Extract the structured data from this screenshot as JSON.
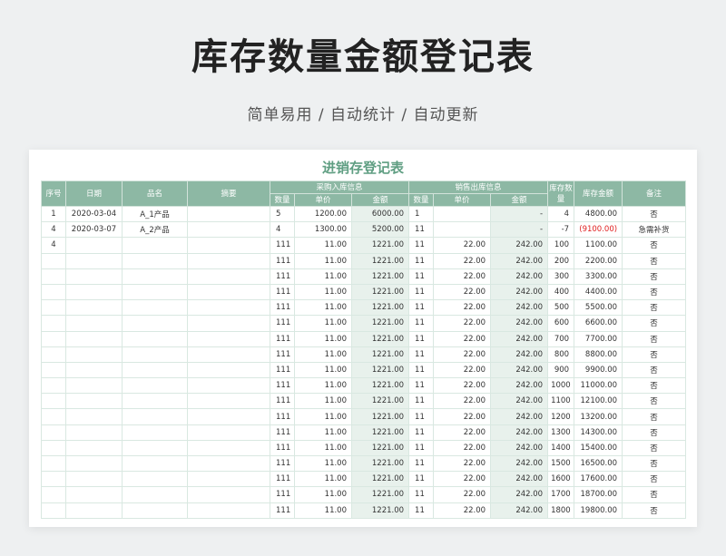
{
  "hero": {
    "title": "库存数量金额登记表",
    "subtitle": "简单易用 / 自动统计 / 自动更新"
  },
  "sheet": {
    "title": "进销存登记表",
    "headers": {
      "seq": "序号",
      "date": "日期",
      "name": "品名",
      "summary": "摘要",
      "in_group": "采购入库信息",
      "out_group": "销售出库信息",
      "stock_qty": "库存数量",
      "stock_amount": "库存金额",
      "remark": "备注",
      "qty": "数量",
      "price": "单价",
      "amount": "金额"
    },
    "rows": [
      {
        "seq": "1",
        "date": "2020-03-04",
        "name": "A_1产品",
        "summary": "",
        "in_qty": "5",
        "in_price": "1200.00",
        "in_amount": "6000.00",
        "out_qty": "1",
        "out_price": "",
        "out_amount": "-",
        "stock_qty": "4",
        "stock_amount": "4800.00",
        "remark": "否",
        "negative": false
      },
      {
        "seq": "4",
        "date": "2020-03-07",
        "name": "A_2产品",
        "summary": "",
        "in_qty": "4",
        "in_price": "1300.00",
        "in_amount": "5200.00",
        "out_qty": "11",
        "out_price": "",
        "out_amount": "-",
        "stock_qty": "-7",
        "stock_amount": "(9100.00)",
        "remark": "急需补货",
        "negative": true
      },
      {
        "seq": "4",
        "date": "",
        "name": "",
        "summary": "",
        "in_qty": "111",
        "in_price": "11.00",
        "in_amount": "1221.00",
        "out_qty": "11",
        "out_price": "22.00",
        "out_amount": "242.00",
        "stock_qty": "100",
        "stock_amount": "1100.00",
        "remark": "否",
        "negative": false
      },
      {
        "seq": "",
        "date": "",
        "name": "",
        "summary": "",
        "in_qty": "111",
        "in_price": "11.00",
        "in_amount": "1221.00",
        "out_qty": "11",
        "out_price": "22.00",
        "out_amount": "242.00",
        "stock_qty": "200",
        "stock_amount": "2200.00",
        "remark": "否",
        "negative": false
      },
      {
        "seq": "",
        "date": "",
        "name": "",
        "summary": "",
        "in_qty": "111",
        "in_price": "11.00",
        "in_amount": "1221.00",
        "out_qty": "11",
        "out_price": "22.00",
        "out_amount": "242.00",
        "stock_qty": "300",
        "stock_amount": "3300.00",
        "remark": "否",
        "negative": false
      },
      {
        "seq": "",
        "date": "",
        "name": "",
        "summary": "",
        "in_qty": "111",
        "in_price": "11.00",
        "in_amount": "1221.00",
        "out_qty": "11",
        "out_price": "22.00",
        "out_amount": "242.00",
        "stock_qty": "400",
        "stock_amount": "4400.00",
        "remark": "否",
        "negative": false
      },
      {
        "seq": "",
        "date": "",
        "name": "",
        "summary": "",
        "in_qty": "111",
        "in_price": "11.00",
        "in_amount": "1221.00",
        "out_qty": "11",
        "out_price": "22.00",
        "out_amount": "242.00",
        "stock_qty": "500",
        "stock_amount": "5500.00",
        "remark": "否",
        "negative": false
      },
      {
        "seq": "",
        "date": "",
        "name": "",
        "summary": "",
        "in_qty": "111",
        "in_price": "11.00",
        "in_amount": "1221.00",
        "out_qty": "11",
        "out_price": "22.00",
        "out_amount": "242.00",
        "stock_qty": "600",
        "stock_amount": "6600.00",
        "remark": "否",
        "negative": false
      },
      {
        "seq": "",
        "date": "",
        "name": "",
        "summary": "",
        "in_qty": "111",
        "in_price": "11.00",
        "in_amount": "1221.00",
        "out_qty": "11",
        "out_price": "22.00",
        "out_amount": "242.00",
        "stock_qty": "700",
        "stock_amount": "7700.00",
        "remark": "否",
        "negative": false
      },
      {
        "seq": "",
        "date": "",
        "name": "",
        "summary": "",
        "in_qty": "111",
        "in_price": "11.00",
        "in_amount": "1221.00",
        "out_qty": "11",
        "out_price": "22.00",
        "out_amount": "242.00",
        "stock_qty": "800",
        "stock_amount": "8800.00",
        "remark": "否",
        "negative": false
      },
      {
        "seq": "",
        "date": "",
        "name": "",
        "summary": "",
        "in_qty": "111",
        "in_price": "11.00",
        "in_amount": "1221.00",
        "out_qty": "11",
        "out_price": "22.00",
        "out_amount": "242.00",
        "stock_qty": "900",
        "stock_amount": "9900.00",
        "remark": "否",
        "negative": false
      },
      {
        "seq": "",
        "date": "",
        "name": "",
        "summary": "",
        "in_qty": "111",
        "in_price": "11.00",
        "in_amount": "1221.00",
        "out_qty": "11",
        "out_price": "22.00",
        "out_amount": "242.00",
        "stock_qty": "1000",
        "stock_amount": "11000.00",
        "remark": "否",
        "negative": false
      },
      {
        "seq": "",
        "date": "",
        "name": "",
        "summary": "",
        "in_qty": "111",
        "in_price": "11.00",
        "in_amount": "1221.00",
        "out_qty": "11",
        "out_price": "22.00",
        "out_amount": "242.00",
        "stock_qty": "1100",
        "stock_amount": "12100.00",
        "remark": "否",
        "negative": false
      },
      {
        "seq": "",
        "date": "",
        "name": "",
        "summary": "",
        "in_qty": "111",
        "in_price": "11.00",
        "in_amount": "1221.00",
        "out_qty": "11",
        "out_price": "22.00",
        "out_amount": "242.00",
        "stock_qty": "1200",
        "stock_amount": "13200.00",
        "remark": "否",
        "negative": false
      },
      {
        "seq": "",
        "date": "",
        "name": "",
        "summary": "",
        "in_qty": "111",
        "in_price": "11.00",
        "in_amount": "1221.00",
        "out_qty": "11",
        "out_price": "22.00",
        "out_amount": "242.00",
        "stock_qty": "1300",
        "stock_amount": "14300.00",
        "remark": "否",
        "negative": false
      },
      {
        "seq": "",
        "date": "",
        "name": "",
        "summary": "",
        "in_qty": "111",
        "in_price": "11.00",
        "in_amount": "1221.00",
        "out_qty": "11",
        "out_price": "22.00",
        "out_amount": "242.00",
        "stock_qty": "1400",
        "stock_amount": "15400.00",
        "remark": "否",
        "negative": false
      },
      {
        "seq": "",
        "date": "",
        "name": "",
        "summary": "",
        "in_qty": "111",
        "in_price": "11.00",
        "in_amount": "1221.00",
        "out_qty": "11",
        "out_price": "22.00",
        "out_amount": "242.00",
        "stock_qty": "1500",
        "stock_amount": "16500.00",
        "remark": "否",
        "negative": false
      },
      {
        "seq": "",
        "date": "",
        "name": "",
        "summary": "",
        "in_qty": "111",
        "in_price": "11.00",
        "in_amount": "1221.00",
        "out_qty": "11",
        "out_price": "22.00",
        "out_amount": "242.00",
        "stock_qty": "1600",
        "stock_amount": "17600.00",
        "remark": "否",
        "negative": false
      },
      {
        "seq": "",
        "date": "",
        "name": "",
        "summary": "",
        "in_qty": "111",
        "in_price": "11.00",
        "in_amount": "1221.00",
        "out_qty": "11",
        "out_price": "22.00",
        "out_amount": "242.00",
        "stock_qty": "1700",
        "stock_amount": "18700.00",
        "remark": "否",
        "negative": false
      },
      {
        "seq": "",
        "date": "",
        "name": "",
        "summary": "",
        "in_qty": "111",
        "in_price": "11.00",
        "in_amount": "1221.00",
        "out_qty": "11",
        "out_price": "22.00",
        "out_amount": "242.00",
        "stock_qty": "1800",
        "stock_amount": "19800.00",
        "remark": "否",
        "negative": false
      }
    ]
  }
}
